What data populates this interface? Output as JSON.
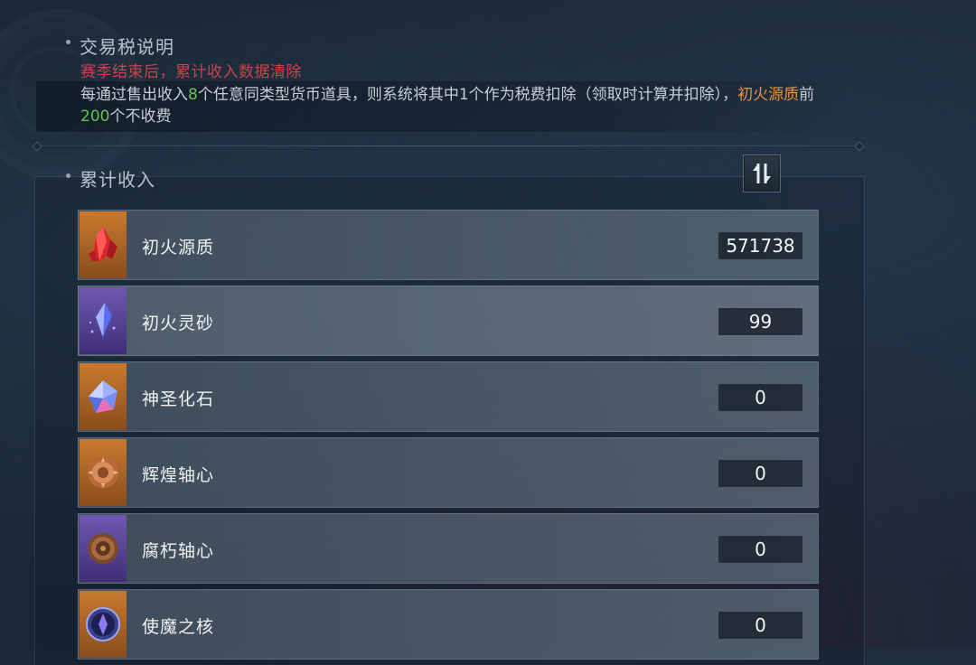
{
  "tax_info": {
    "title": "交易税说明",
    "warning": "赛季结束后，累计收入数据清除",
    "desc_part1": "每通过售出收入",
    "desc_num": "8",
    "desc_part2": "个任意同类型货币道具，则系统将其中1个作为税费扣除（领取时计算并扣除），",
    "desc_item": "初火源质",
    "desc_part3": "前",
    "desc_limit": "200",
    "desc_part4": "个不收费"
  },
  "income": {
    "title": "累计收入",
    "sort_icon": "sort-swap-icon",
    "items": [
      {
        "name": "初火源质",
        "value": "571738",
        "icon": "red-crystal-icon",
        "rarity_color": "#c97a2e"
      },
      {
        "name": "初火灵砂",
        "value": "99",
        "icon": "purple-shard-icon",
        "rarity_color": "#6f58b0"
      },
      {
        "name": "神圣化石",
        "value": "0",
        "icon": "holy-gem-icon",
        "rarity_color": "#c97a2e"
      },
      {
        "name": "辉煌轴心",
        "value": "0",
        "icon": "golden-gear-icon",
        "rarity_color": "#c97a2e"
      },
      {
        "name": "腐朽轴心",
        "value": "0",
        "icon": "bronze-gear-icon",
        "rarity_color": "#6f58b0"
      },
      {
        "name": "使魔之核",
        "value": "0",
        "icon": "dark-core-icon",
        "rarity_color": "#c97a2e"
      }
    ]
  },
  "colors": {
    "warning": "#c9434a",
    "highlight_green": "#63c351",
    "highlight_orange": "#e5923b"
  }
}
